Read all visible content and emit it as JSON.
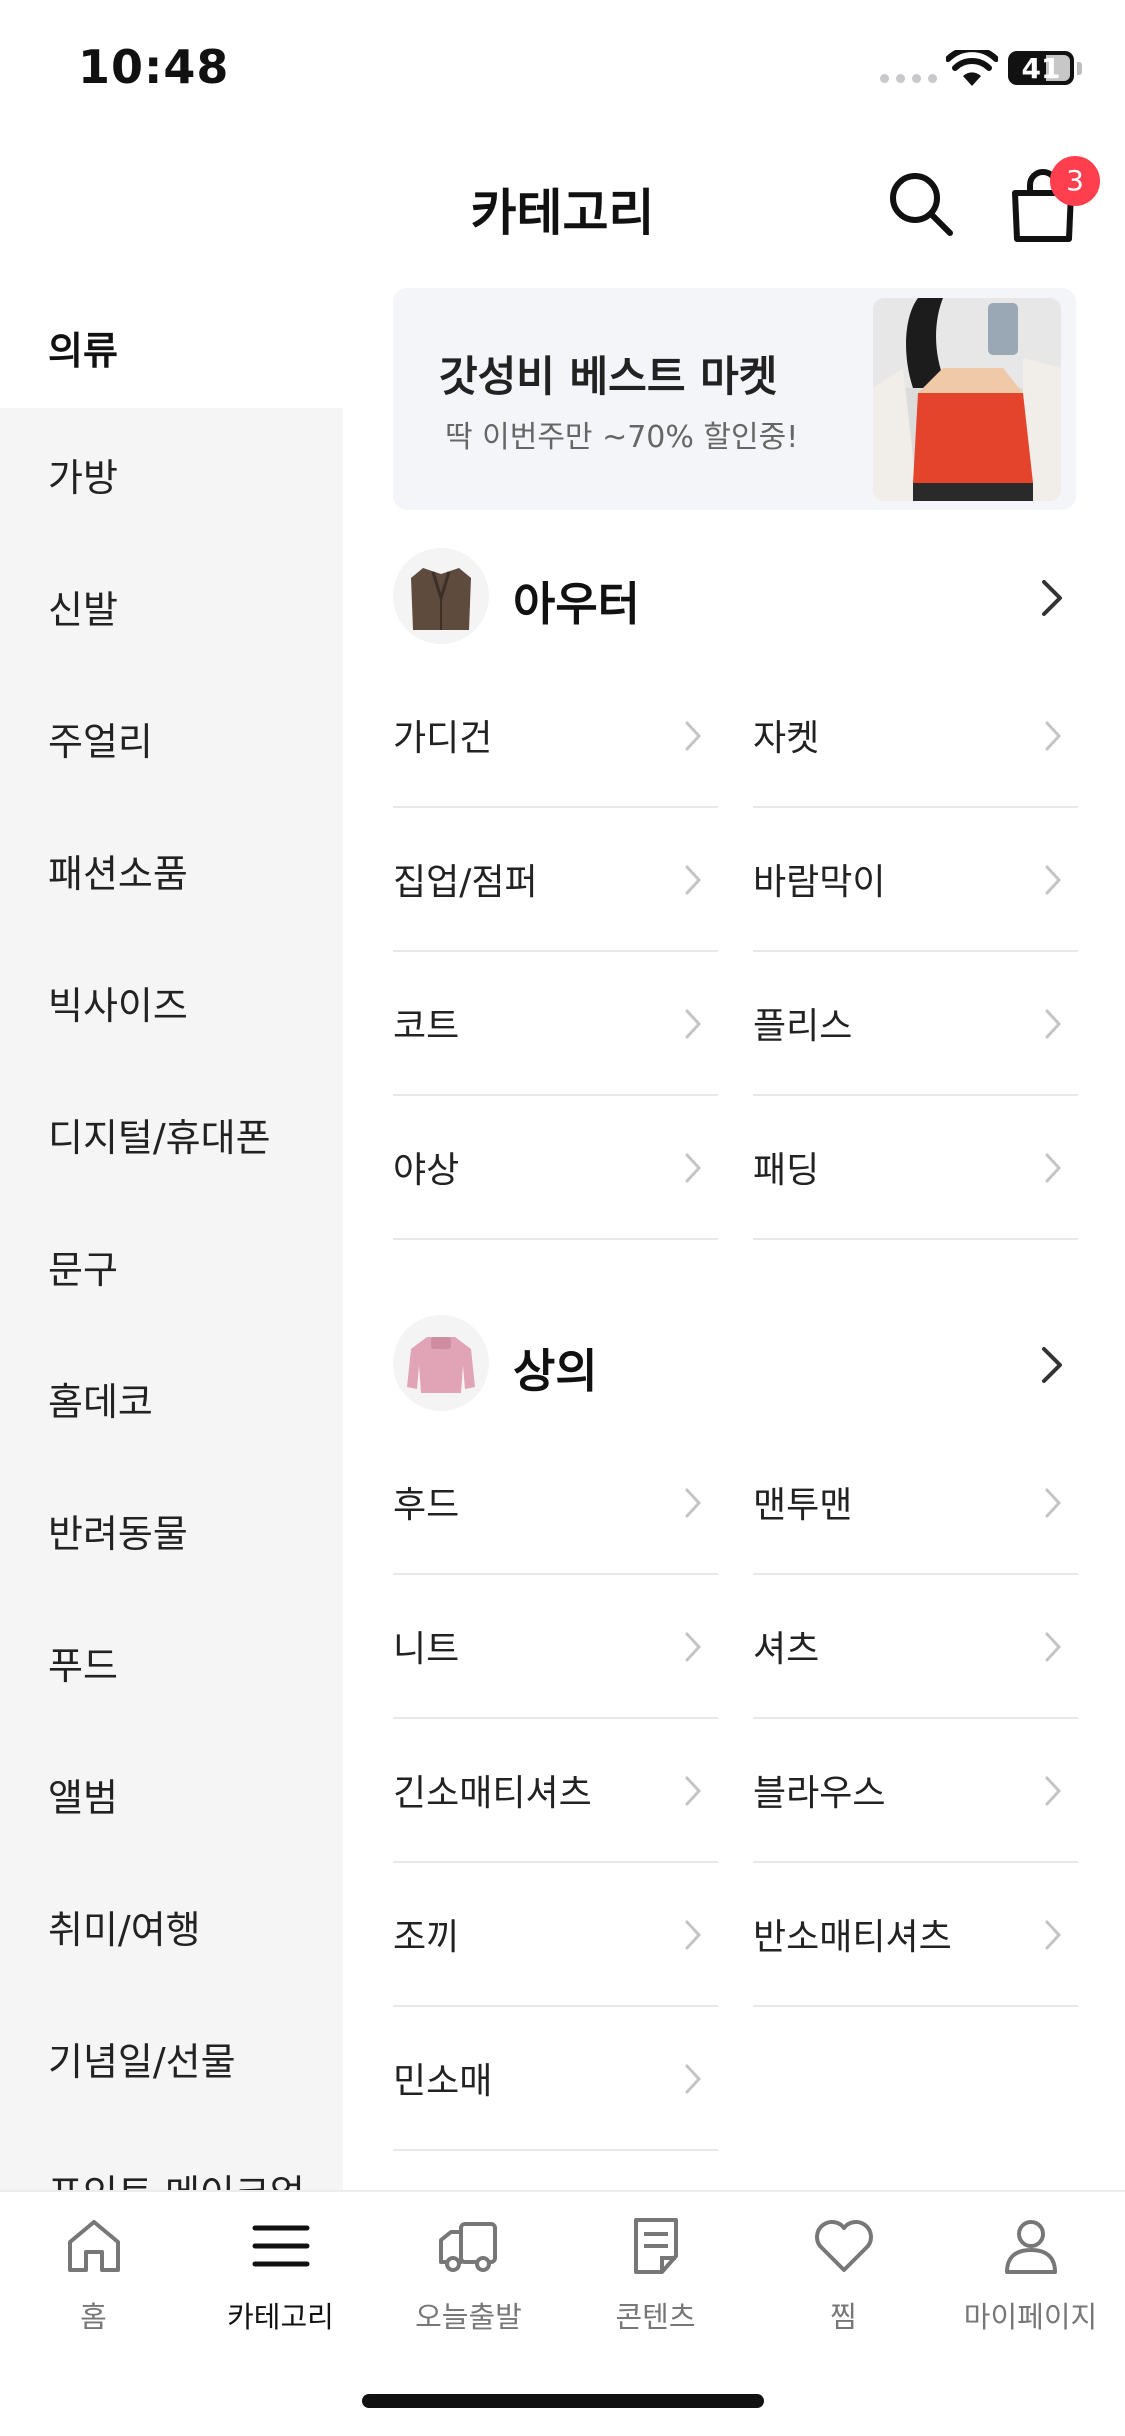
{
  "status_bar": {
    "time": "10:48",
    "battery": "41"
  },
  "header": {
    "title": "카테고리",
    "cart_count": "3"
  },
  "sidebar": {
    "items": [
      {
        "label": "의류"
      },
      {
        "label": "가방"
      },
      {
        "label": "신발"
      },
      {
        "label": "주얼리"
      },
      {
        "label": "패션소품"
      },
      {
        "label": "빅사이즈"
      },
      {
        "label": "디지털/휴대폰"
      },
      {
        "label": "문구"
      },
      {
        "label": "홈데코"
      },
      {
        "label": "반려동물"
      },
      {
        "label": "푸드"
      },
      {
        "label": "앨범"
      },
      {
        "label": "취미/여행"
      },
      {
        "label": "기념일/선물"
      },
      {
        "label": "포인트 메이크업"
      }
    ]
  },
  "banner": {
    "title": "갓성비 베스트 마켓",
    "subtitle": "딱 이번주만 ~70% 할인중!"
  },
  "sections": [
    {
      "title": "아우터",
      "items": [
        "가디건",
        "자켓",
        "집업/점퍼",
        "바람막이",
        "코트",
        "플리스",
        "야상",
        "패딩"
      ]
    },
    {
      "title": "상의",
      "items": [
        "후드",
        "맨투맨",
        "니트",
        "셔츠",
        "긴소매티셔츠",
        "블라우스",
        "조끼",
        "반소매티셔츠",
        "민소매"
      ]
    }
  ],
  "tabbar": {
    "tabs": [
      {
        "label": "홈",
        "icon": "home-icon"
      },
      {
        "label": "카테고리",
        "icon": "menu-icon"
      },
      {
        "label": "오늘출발",
        "icon": "truck-icon"
      },
      {
        "label": "콘텐츠",
        "icon": "document-icon"
      },
      {
        "label": "찜",
        "icon": "heart-icon"
      },
      {
        "label": "마이페이지",
        "icon": "person-icon"
      }
    ]
  },
  "colors": {
    "accent_badge": "#ff3f4d",
    "sidebar_bg": "#f5f5f5",
    "banner_bg": "#f4f5f8"
  }
}
